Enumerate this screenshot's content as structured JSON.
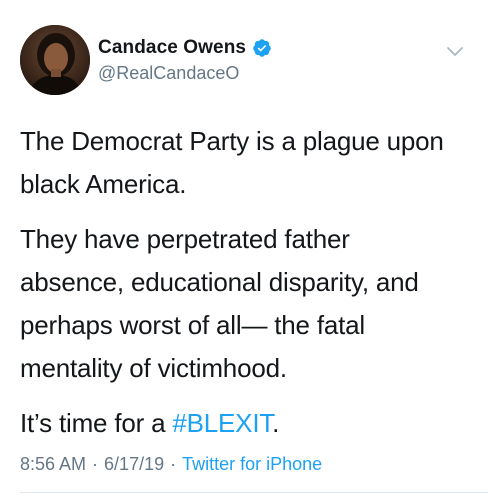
{
  "author": {
    "display_name": "Candace Owens",
    "handle": "@RealCandaceO",
    "verified_icon": "verified-badge-icon",
    "avatar_icon": "avatar"
  },
  "menu_icon": "chevron-down-icon",
  "tweet": {
    "paragraph_1": "The Democrat Party is a plague upon black America.",
    "paragraph_2_line_1": "They have perpetrated father",
    "paragraph_2_line_2": "absence, educational disparity, and",
    "paragraph_2_line_3": "perhaps worst of all— the fatal",
    "paragraph_2_line_4": "mentality of victimhood.",
    "paragraph_3_prefix": "It’s time for a ",
    "hashtag": "#BLEXIT",
    "paragraph_3_suffix": "."
  },
  "meta": {
    "time": "8:56 AM",
    "separator_1": "·",
    "date": "6/17/19",
    "separator_2": "·",
    "source": "Twitter for iPhone"
  },
  "colors": {
    "text": "#14171a",
    "secondary": "#657786",
    "link": "#1da1f2",
    "divider": "#e1e8ed"
  }
}
